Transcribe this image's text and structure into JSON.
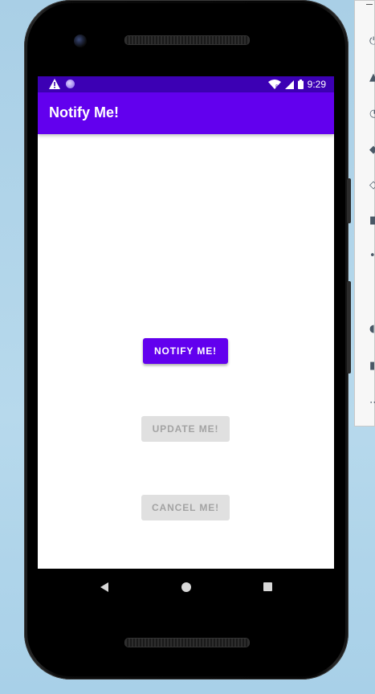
{
  "app": {
    "title": "Notify Me!"
  },
  "status_bar": {
    "time": "9:29",
    "left_icons": [
      "warning-icon",
      "notification-dot-icon"
    ],
    "right_icons": [
      "wifi-icon",
      "signal-icon",
      "battery-icon"
    ]
  },
  "buttons": {
    "notify": {
      "label": "NOTIFY ME!",
      "enabled": true
    },
    "update": {
      "label": "UPDATE ME!",
      "enabled": false
    },
    "cancel": {
      "label": "CANCEL ME!",
      "enabled": false
    }
  },
  "nav_bar": {
    "icons": [
      "back-icon",
      "home-icon",
      "recents-icon"
    ]
  },
  "emulator_panel": {
    "tools": [
      "power-icon",
      "volume-up-icon",
      "volume-down-icon",
      "rotate-left-icon",
      "rotate-right-icon",
      "camera-icon",
      "zoom-icon",
      "back-icon",
      "home-icon",
      "overview-icon",
      "more-icon"
    ]
  },
  "colors": {
    "primary": "#6200ee",
    "status_bar": "#3c00b4",
    "disabled_bg": "#e0e0e0",
    "disabled_text": "#a3a3a3"
  }
}
